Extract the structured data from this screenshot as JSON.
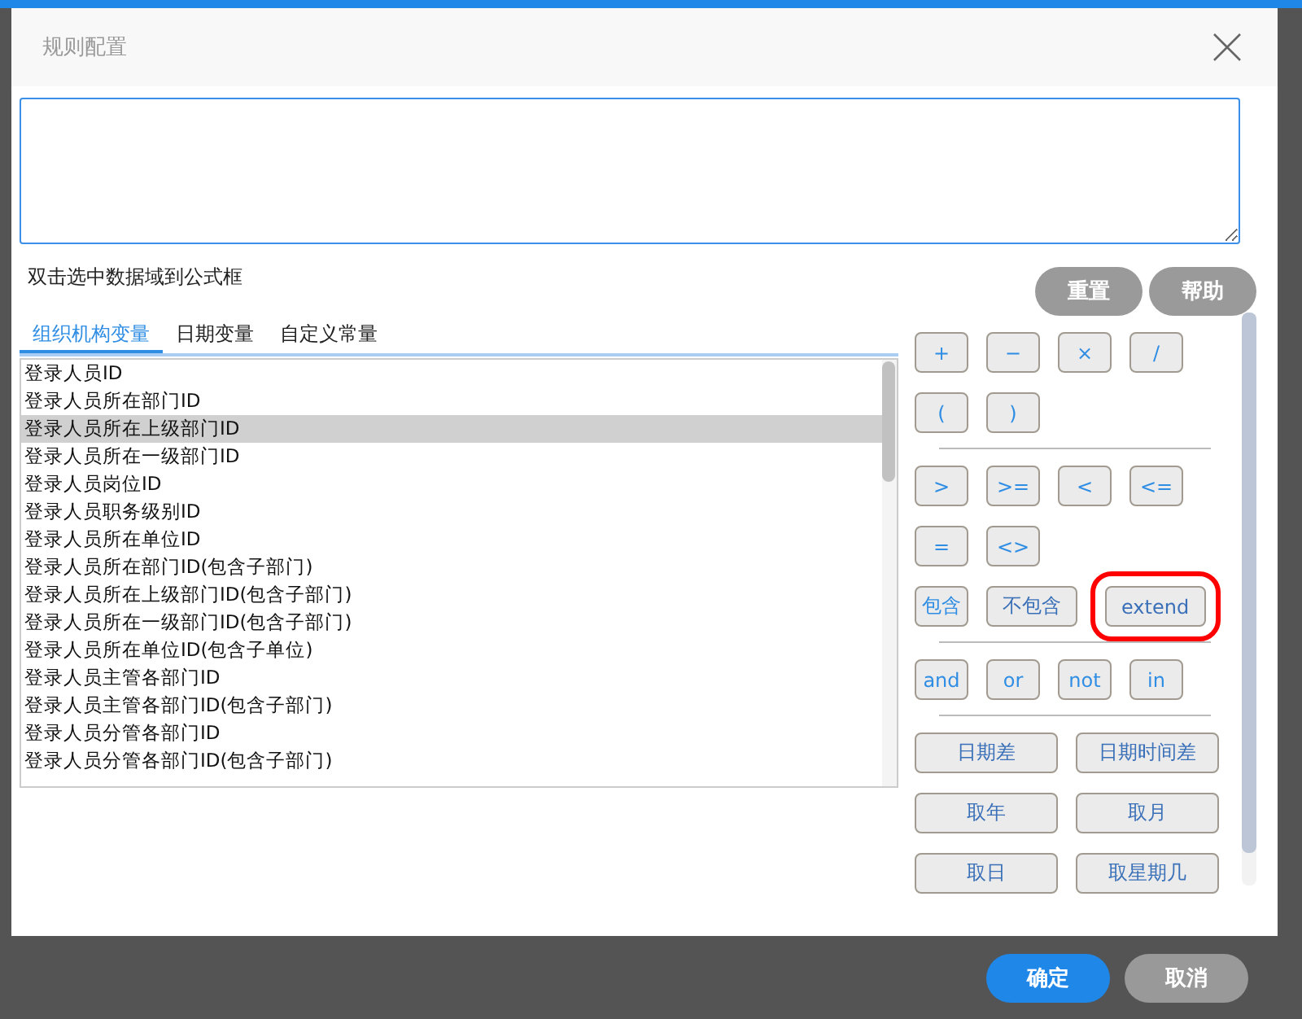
{
  "dialog": {
    "title": "规则配置"
  },
  "hint": "双击选中数据域到公式框",
  "tool_buttons": [
    {
      "label": "重置"
    },
    {
      "label": "帮助"
    }
  ],
  "tabs": [
    {
      "label": "组织机构变量",
      "selected": true
    },
    {
      "label": "日期变量",
      "selected": false
    },
    {
      "label": "自定义常量",
      "selected": false
    }
  ],
  "variables": [
    {
      "label": "登录人员ID",
      "selected": false
    },
    {
      "label": "登录人员所在部门ID",
      "selected": false
    },
    {
      "label": "登录人员所在上级部门ID",
      "selected": true
    },
    {
      "label": "登录人员所在一级部门ID",
      "selected": false
    },
    {
      "label": "登录人员岗位ID",
      "selected": false
    },
    {
      "label": "登录人员职务级别ID",
      "selected": false
    },
    {
      "label": "登录人员所在单位ID",
      "selected": false
    },
    {
      "label": "登录人员所在部门ID(包含子部门)",
      "selected": false
    },
    {
      "label": "登录人员所在上级部门ID(包含子部门)",
      "selected": false
    },
    {
      "label": "登录人员所在一级部门ID(包含子部门)",
      "selected": false
    },
    {
      "label": "登录人员所在单位ID(包含子单位)",
      "selected": false
    },
    {
      "label": "登录人员主管各部门ID",
      "selected": false
    },
    {
      "label": "登录人员主管各部门ID(包含子部门)",
      "selected": false
    },
    {
      "label": "登录人员分管各部门ID",
      "selected": false
    },
    {
      "label": "登录人员分管各部门ID(包含子部门)",
      "selected": false
    }
  ],
  "operator_groups": [
    {
      "lines": [
        {
          "buttons": [
            {
              "label": "+",
              "kind": "small",
              "highlighted": false
            },
            {
              "label": "−",
              "kind": "small",
              "highlighted": false
            },
            {
              "label": "×",
              "kind": "small",
              "highlighted": false
            },
            {
              "label": "/",
              "kind": "small",
              "highlighted": false
            }
          ]
        },
        {
          "buttons": [
            {
              "label": "(",
              "kind": "small",
              "highlighted": false
            },
            {
              "label": ")",
              "kind": "small",
              "highlighted": false
            }
          ]
        }
      ]
    },
    {
      "lines": [
        {
          "buttons": [
            {
              "label": ">",
              "kind": "small",
              "highlighted": false
            },
            {
              "label": ">=",
              "kind": "small",
              "highlighted": false
            },
            {
              "label": "<",
              "kind": "small",
              "highlighted": false
            },
            {
              "label": "<=",
              "kind": "small",
              "highlighted": false
            }
          ]
        },
        {
          "buttons": [
            {
              "label": "=",
              "kind": "small",
              "highlighted": false
            },
            {
              "label": "<>",
              "kind": "small",
              "highlighted": false
            }
          ]
        },
        {
          "buttons": [
            {
              "label": "包含",
              "kind": "small",
              "highlighted": false
            },
            {
              "label": "不包含",
              "kind": "text",
              "highlighted": false
            },
            {
              "label": "extend",
              "kind": "text",
              "highlighted": true
            }
          ]
        }
      ]
    },
    {
      "lines": [
        {
          "buttons": [
            {
              "label": "and",
              "kind": "small",
              "highlighted": false
            },
            {
              "label": "or",
              "kind": "small",
              "highlighted": false
            },
            {
              "label": "not",
              "kind": "small",
              "highlighted": false
            },
            {
              "label": "in",
              "kind": "small",
              "highlighted": false
            }
          ]
        }
      ]
    },
    {
      "lines": [
        {
          "buttons": [
            {
              "label": "日期差",
              "kind": "wide",
              "highlighted": false
            },
            {
              "label": "日期时间差",
              "kind": "wide",
              "highlighted": false
            }
          ]
        },
        {
          "buttons": [
            {
              "label": "取年",
              "kind": "wide",
              "highlighted": false
            },
            {
              "label": "取月",
              "kind": "wide",
              "highlighted": false
            }
          ]
        },
        {
          "buttons": [
            {
              "label": "取日",
              "kind": "wide",
              "highlighted": false
            },
            {
              "label": "取星期几",
              "kind": "wide",
              "highlighted": false
            }
          ]
        }
      ]
    }
  ],
  "footer_buttons": [
    {
      "label": "确定",
      "kind": "primary"
    },
    {
      "label": "取消",
      "kind": "secondary"
    }
  ]
}
